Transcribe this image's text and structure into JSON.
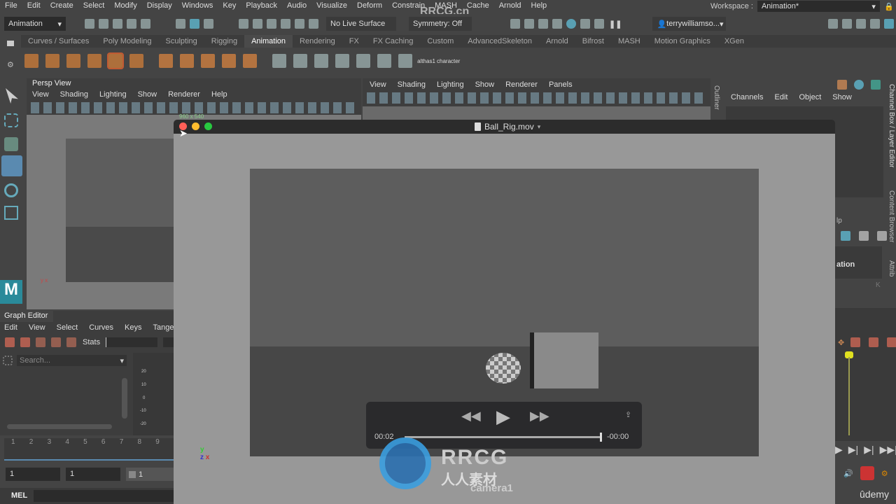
{
  "menubar": {
    "items": [
      "File",
      "Edit",
      "Create",
      "Select",
      "Modify",
      "Display",
      "Windows",
      "Key",
      "Playback",
      "Audio",
      "Visualize",
      "Deform",
      "Constrain",
      "MASH",
      "Cache",
      "Arnold",
      "Help"
    ],
    "workspace_label": "Workspace :",
    "workspace_value": "Animation*"
  },
  "toolbar": {
    "mode": "Animation",
    "live_surface": "No Live Surface",
    "symmetry": "Symmetry: Off",
    "user": "terrywilliamso..."
  },
  "shelf": {
    "tabs": [
      "Curves / Surfaces",
      "Poly Modeling",
      "Sculpting",
      "Rigging",
      "Animation",
      "Rendering",
      "FX",
      "FX Caching",
      "Custom",
      "AdvancedSkeleton",
      "Arnold",
      "Bifrost",
      "MASH",
      "Motion Graphics",
      "XGen"
    ],
    "active": "Animation",
    "icon_labels": [
      "althas1",
      "character"
    ]
  },
  "persp": {
    "title": "Persp View",
    "menu": [
      "View",
      "Shading",
      "Lighting",
      "Show",
      "Renderer",
      "Help"
    ],
    "resolution": "960 x 540"
  },
  "viewport2": {
    "menu": [
      "View",
      "Shading",
      "Lighting",
      "Show",
      "Renderer",
      "Panels"
    ]
  },
  "outliner": {
    "label": "Outliner"
  },
  "channel_box": {
    "menu": [
      "Channels",
      "Edit",
      "Object",
      "Show"
    ],
    "partial_texts": [
      "lp",
      "ation",
      "K"
    ]
  },
  "side_tabs": [
    "Channel Box / Layer Editor",
    "Content Browser",
    "Attrib"
  ],
  "graph_editor": {
    "title": "Graph Editor",
    "menu": [
      "Edit",
      "View",
      "Select",
      "Curves",
      "Keys",
      "Tangents"
    ],
    "stats_label": "Stats",
    "search_placeholder": "Search...",
    "y_ticks": [
      "20",
      "10",
      "0",
      "-10",
      "-20"
    ]
  },
  "timeline": {
    "ticks": [
      "1",
      "2",
      "3",
      "4",
      "5",
      "6",
      "7",
      "8",
      "9"
    ],
    "start": "1",
    "range_start": "1",
    "anim_start": "1"
  },
  "command_line": {
    "label": "MEL"
  },
  "player": {
    "filename": "Ball_Rig.mov",
    "elapsed": "00:02",
    "remaining": "-00:00",
    "progress": 0.99,
    "camera_label": "camera1"
  },
  "watermark": {
    "top": "RRCG.cn",
    "logo_text": "RRCG",
    "logo_sub": "人人素材",
    "corner": "ûdemy"
  },
  "colors": {
    "accent": "#5fb8d0",
    "close": "#ff5f57",
    "minimize": "#febc2e",
    "zoom": "#28c840",
    "timeline_marker": "#e0e020"
  }
}
